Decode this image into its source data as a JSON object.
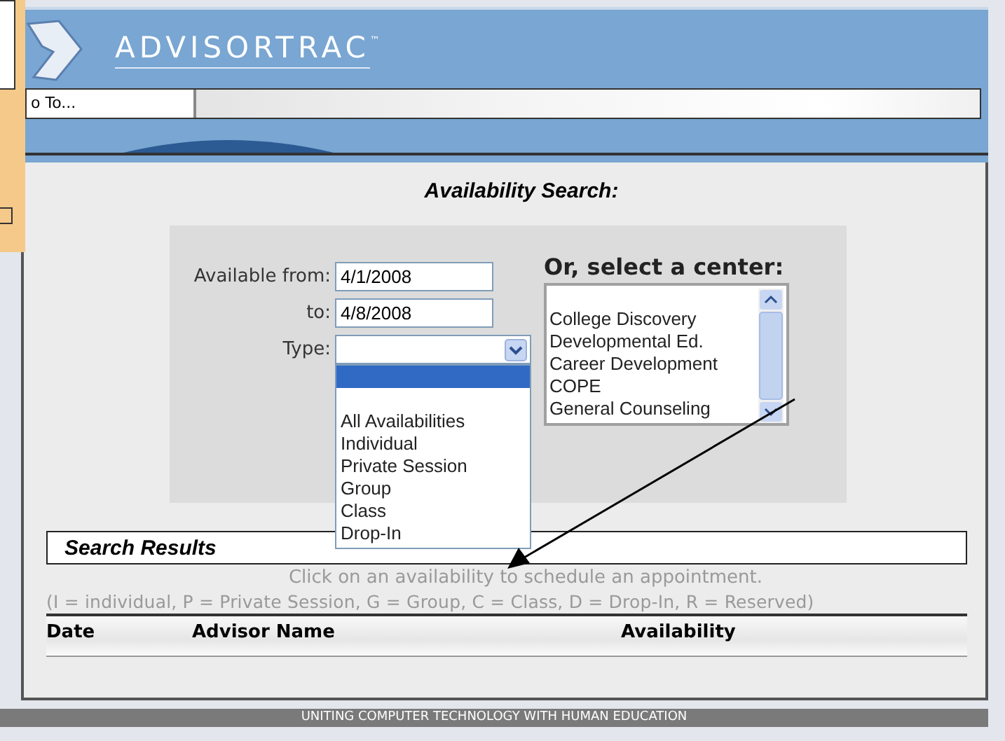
{
  "logo": {
    "text": "ADVISORTRAC",
    "trademark": "™"
  },
  "nav": {
    "go_to": "o To..."
  },
  "title": "Availability Search:",
  "form": {
    "from_label": "Available from:",
    "from_value": "4/1/2008",
    "to_label": "to:",
    "to_value": "4/8/2008",
    "type_label": "Type:",
    "type_dropdown": {
      "expanded": true,
      "blank_rows": [
        {
          "selected": true
        },
        {
          "selected": false
        }
      ],
      "options": [
        {
          "label": "All Availabilities",
          "selected": false
        },
        {
          "label": "Individual",
          "selected": false
        },
        {
          "label": "Private Session",
          "selected": false
        },
        {
          "label": "Group",
          "selected": false
        },
        {
          "label": "Class",
          "selected": false
        },
        {
          "label": "Drop-In",
          "selected": false
        }
      ]
    }
  },
  "center": {
    "heading": "Or, select a center:",
    "items": [
      "College Discovery",
      "Developmental Ed.",
      "Career Development",
      "COPE",
      "General Counseling"
    ]
  },
  "results": {
    "heading": "Search Results",
    "hint": "Click on an availability to schedule an appointment.",
    "legend": "(I = individual, P = Private Session, G = Group, C = Class, D = Drop-In, R = Reserved)",
    "columns": [
      "Date",
      "Advisor Name",
      "Availability"
    ]
  },
  "footer": "UNITING COMPUTER TECHNOLOGY WITH HUMAN EDUCATION"
}
